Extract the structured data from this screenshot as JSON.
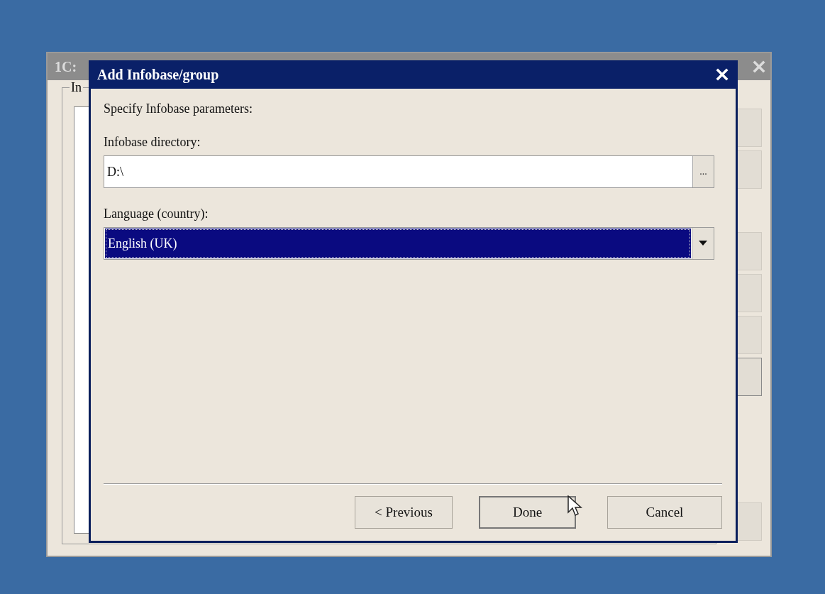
{
  "background_window": {
    "title": "1C:",
    "group_label": "In"
  },
  "dialog": {
    "title": "Add Infobase/group",
    "prompt": "Specify Infobase parameters:",
    "fields": [
      {
        "kind": "path",
        "label": "Infobase directory:",
        "value": "D:\\",
        "browse": "...",
        "focused": false
      },
      {
        "kind": "dropdown",
        "label": "Language (country):",
        "value": "English (UK)",
        "focused": true
      }
    ],
    "buttons": [
      {
        "label": "< Previous",
        "default": false
      },
      {
        "label": "Done",
        "default": true
      },
      {
        "label": "Cancel",
        "default": false
      }
    ]
  }
}
